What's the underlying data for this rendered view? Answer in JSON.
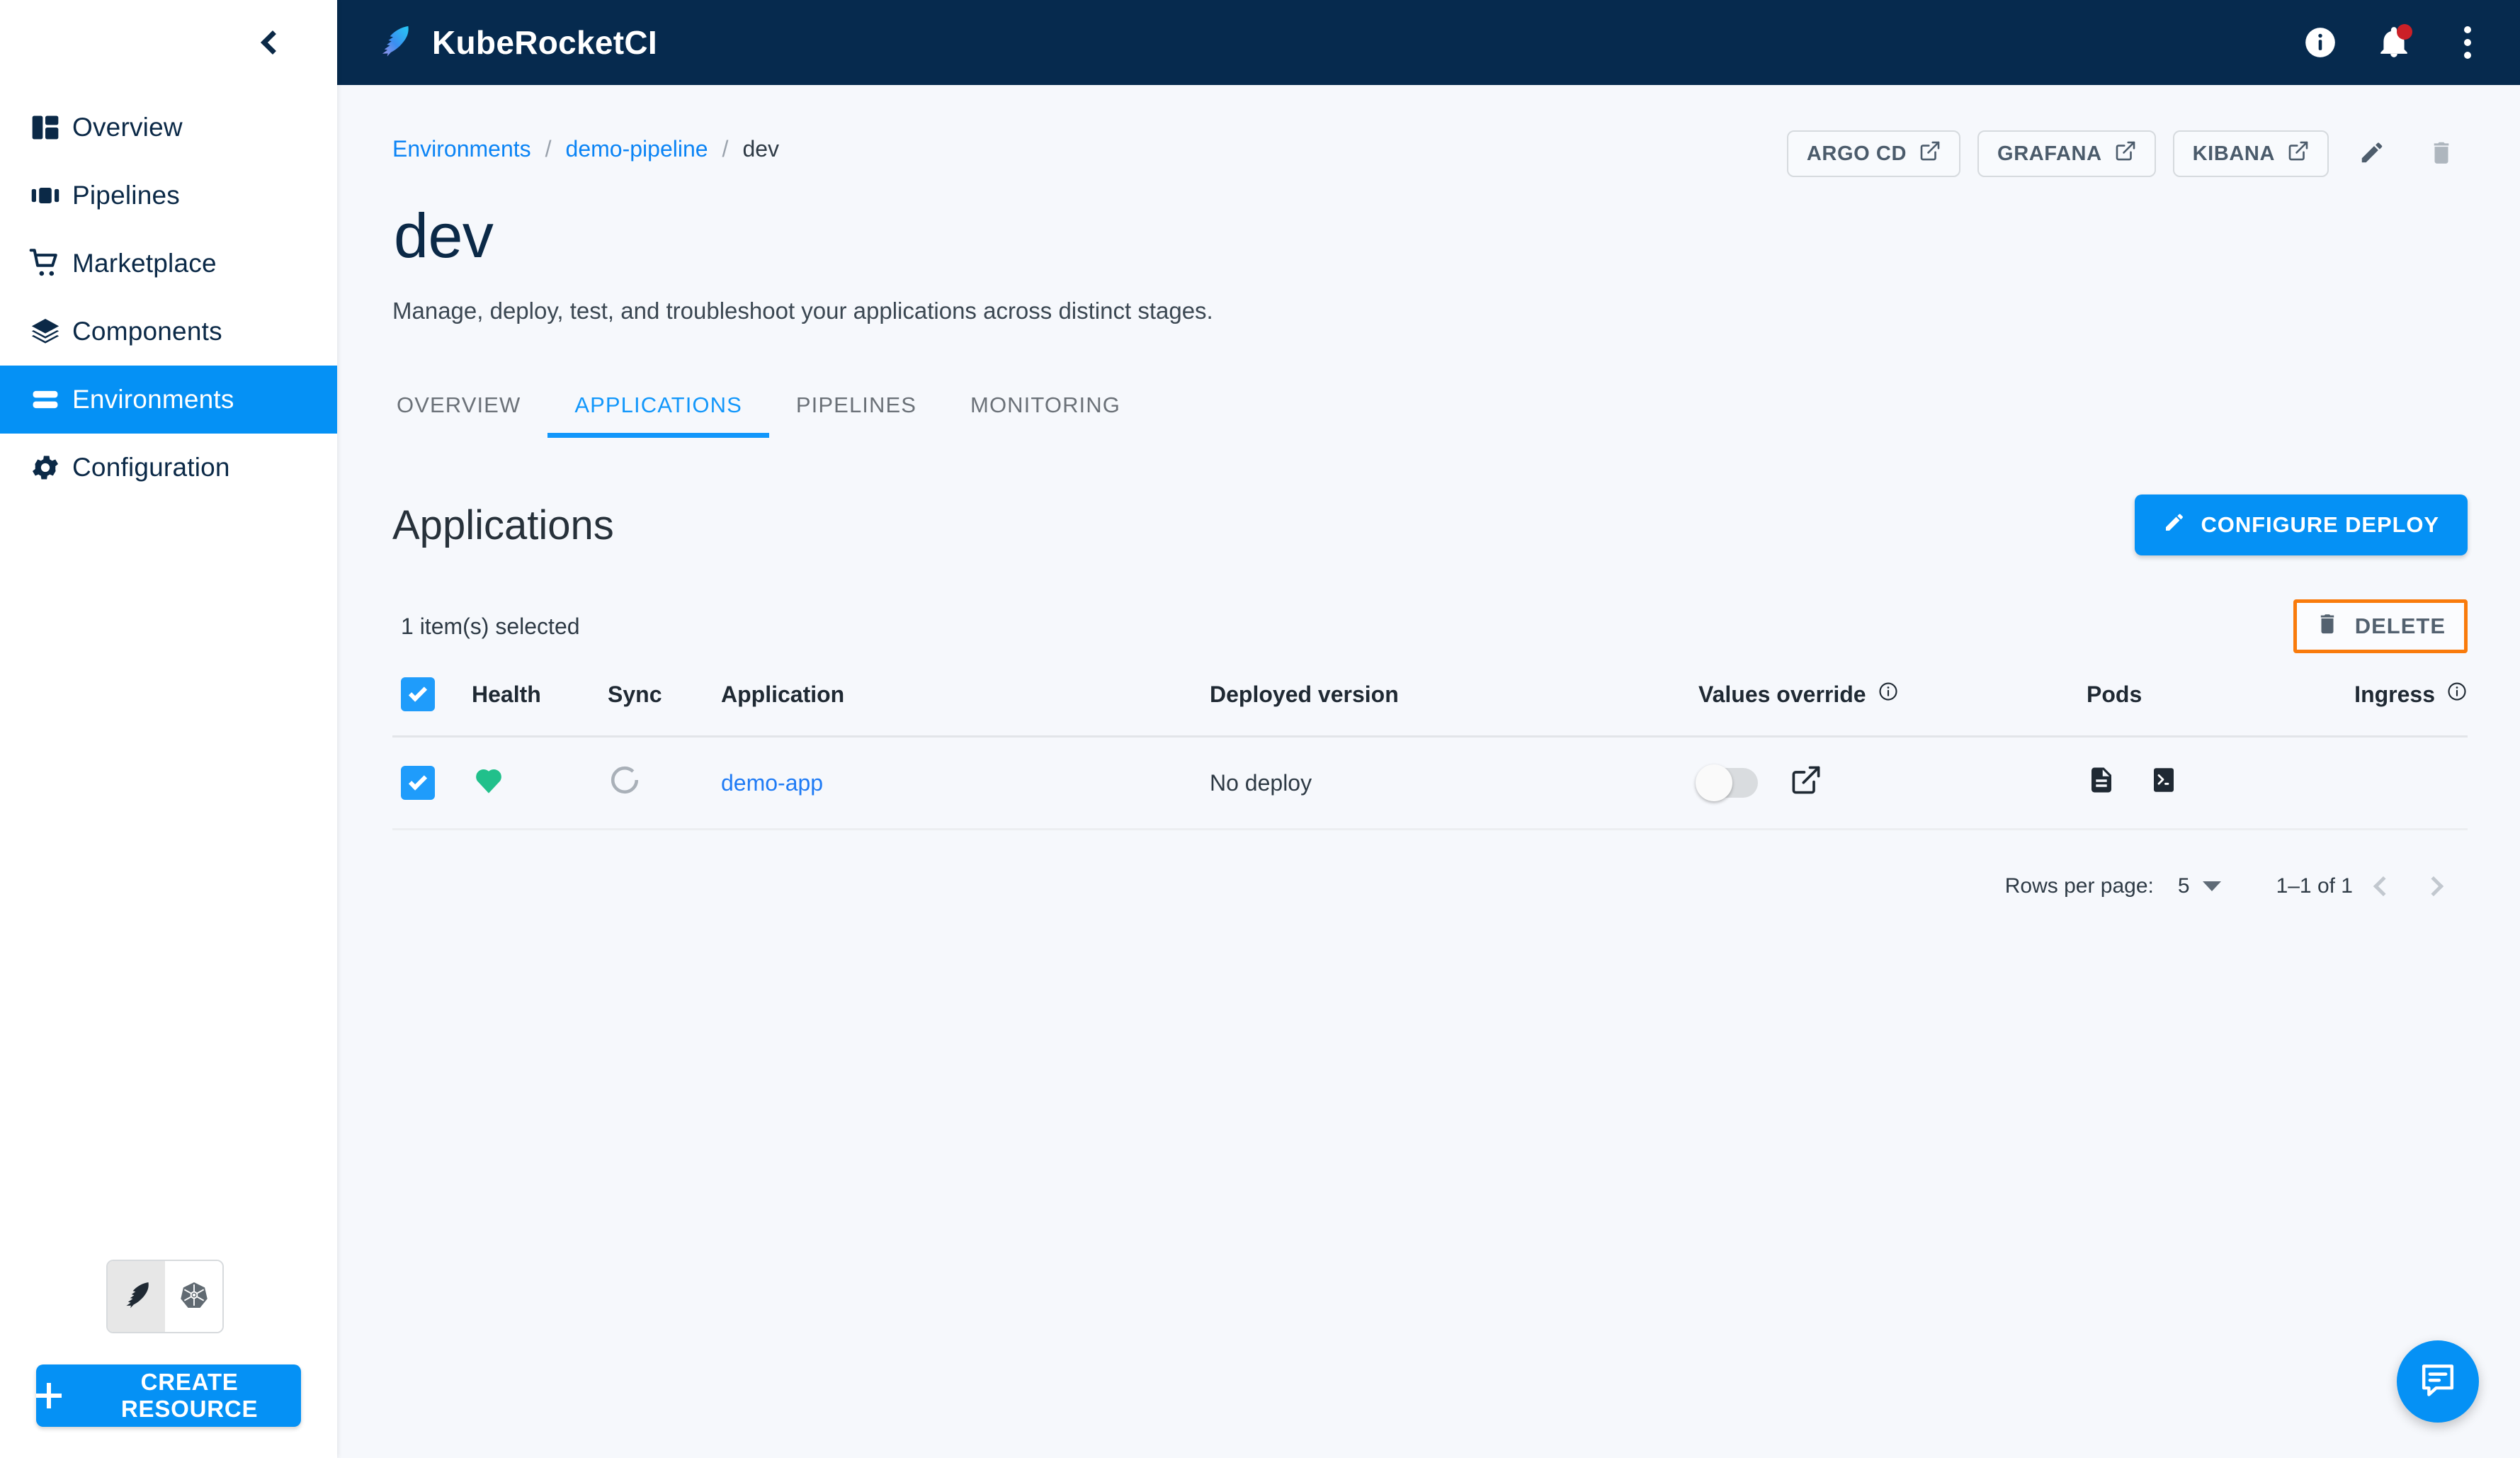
{
  "app": {
    "brand_name": "KubeRocketCI"
  },
  "sidebar": {
    "collapse_tooltip": "Collapse",
    "items": [
      {
        "label": "Overview",
        "icon": "dashboard-icon",
        "active": false
      },
      {
        "label": "Pipelines",
        "icon": "pipelines-icon",
        "active": false
      },
      {
        "label": "Marketplace",
        "icon": "cart-icon",
        "active": false
      },
      {
        "label": "Components",
        "icon": "layers-icon",
        "active": false
      },
      {
        "label": "Environments",
        "icon": "environments-icon",
        "active": true
      },
      {
        "label": "Configuration",
        "icon": "gear-icon",
        "active": false
      }
    ],
    "mode_toggle": [
      {
        "icon": "kuberocketci-feather-icon",
        "selected": true
      },
      {
        "icon": "kubernetes-icon",
        "selected": false
      }
    ],
    "create_button": "CREATE RESOURCE"
  },
  "topbar": {
    "icons": [
      "info-icon",
      "notifications-bell-icon",
      "more-vertical-icon"
    ],
    "notification_badge": true
  },
  "breadcrumb": {
    "items": [
      "Environments",
      "demo-pipeline",
      "dev"
    ],
    "separator": "/"
  },
  "header_actions": {
    "links": [
      "ARGO CD",
      "GRAFANA",
      "KIBANA"
    ],
    "edit_icon": "pencil-icon",
    "delete_icon": "trash-icon"
  },
  "page": {
    "title": "dev",
    "description": "Manage, deploy, test, and troubleshoot your applications across distinct stages."
  },
  "tabs": [
    {
      "label": "OVERVIEW",
      "active": false
    },
    {
      "label": "APPLICATIONS",
      "active": true
    },
    {
      "label": "PIPELINES",
      "active": false
    },
    {
      "label": "MONITORING",
      "active": false
    }
  ],
  "applications_section": {
    "title": "Applications",
    "configure_deploy_button": "CONFIGURE DEPLOY",
    "selection_text": "1 item(s) selected",
    "delete_button": "DELETE",
    "delete_highlight_color": "#f97b0c"
  },
  "table": {
    "columns": [
      "Health",
      "Sync",
      "Application",
      "Deployed version",
      "Values override",
      "Pods",
      "Ingress"
    ],
    "header_checkbox_checked": true,
    "rows": [
      {
        "checked": true,
        "health": "healthy",
        "health_color": "#21c08b",
        "sync": "unknown",
        "application": "demo-app",
        "deployed_version": "No deploy",
        "values_override": false,
        "values_override_link_icon": "external-link-icon",
        "pods_icons": [
          "logs-document-icon",
          "terminal-icon"
        ],
        "ingress": ""
      }
    ]
  },
  "pagination": {
    "rows_per_page_label": "Rows per page:",
    "rows_per_page_value": "5",
    "range": "1–1 of 1",
    "prev_icon": "chevron-left-icon",
    "next_icon": "chevron-right-icon"
  },
  "fab": {
    "icon": "chat-icon"
  },
  "colors": {
    "accent": "#0591f5",
    "topbar": "#062a4e",
    "link": "#1f7bf5",
    "healthy": "#21c08b",
    "highlight": "#f97b0c",
    "background": "#f6f8fc"
  }
}
